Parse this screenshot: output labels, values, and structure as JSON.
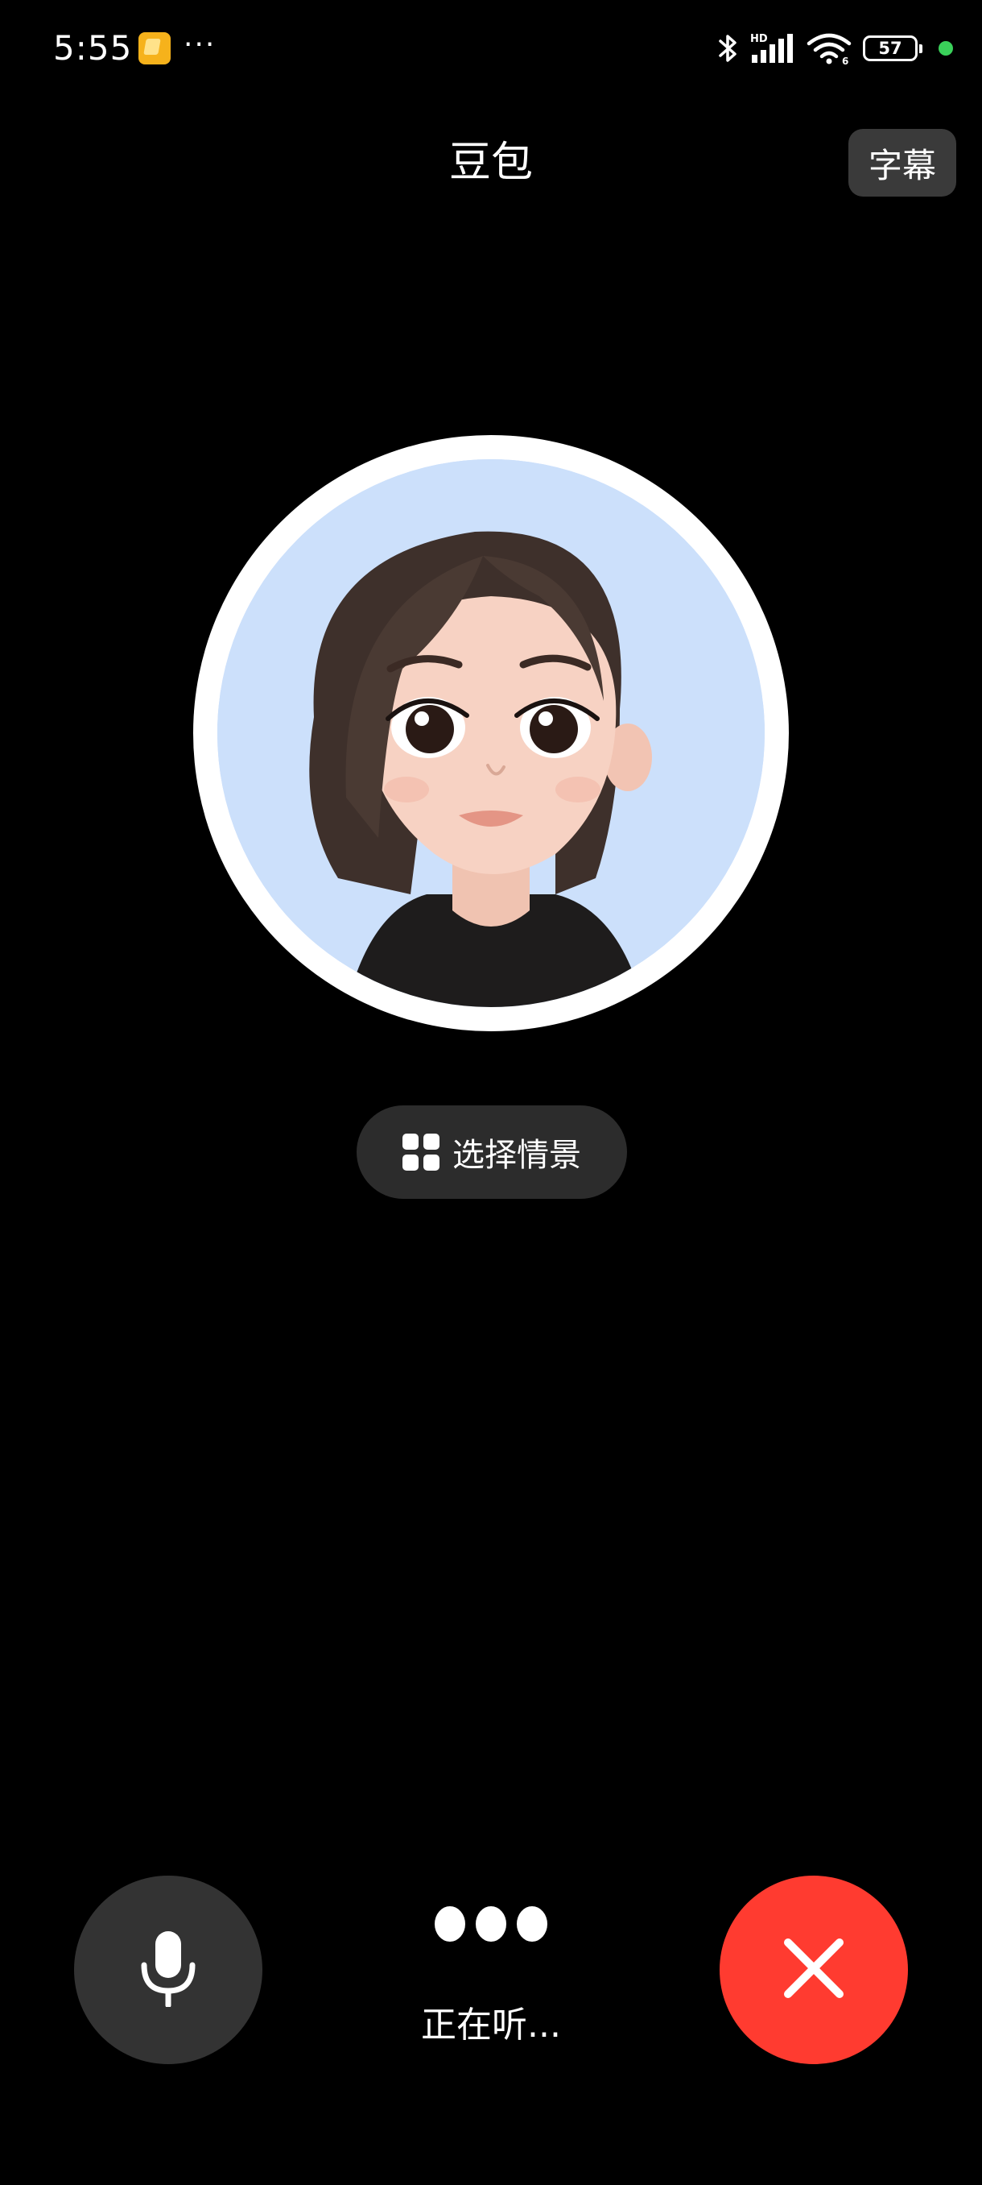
{
  "status_bar": {
    "time": "5:55",
    "more": "···",
    "battery": "57",
    "icons": [
      "app-notification-icon",
      "bluetooth-icon",
      "hd-signal-icon",
      "wifi-icon",
      "battery-icon",
      "privacy-indicator-dot"
    ],
    "indicator_color": "#3ad15a"
  },
  "header": {
    "title": "豆包",
    "subtitle_button": "字幕"
  },
  "scene_button": {
    "label": "选择情景",
    "icon": "grid-icon"
  },
  "controls": {
    "mic_icon": "microphone-icon",
    "hangup_icon": "close-icon",
    "status_text": "正在听..."
  },
  "colors": {
    "background": "#000000",
    "hangup": "#ff3b30",
    "mic_button": "#333333",
    "avatar_bg": "#cce0fb"
  }
}
